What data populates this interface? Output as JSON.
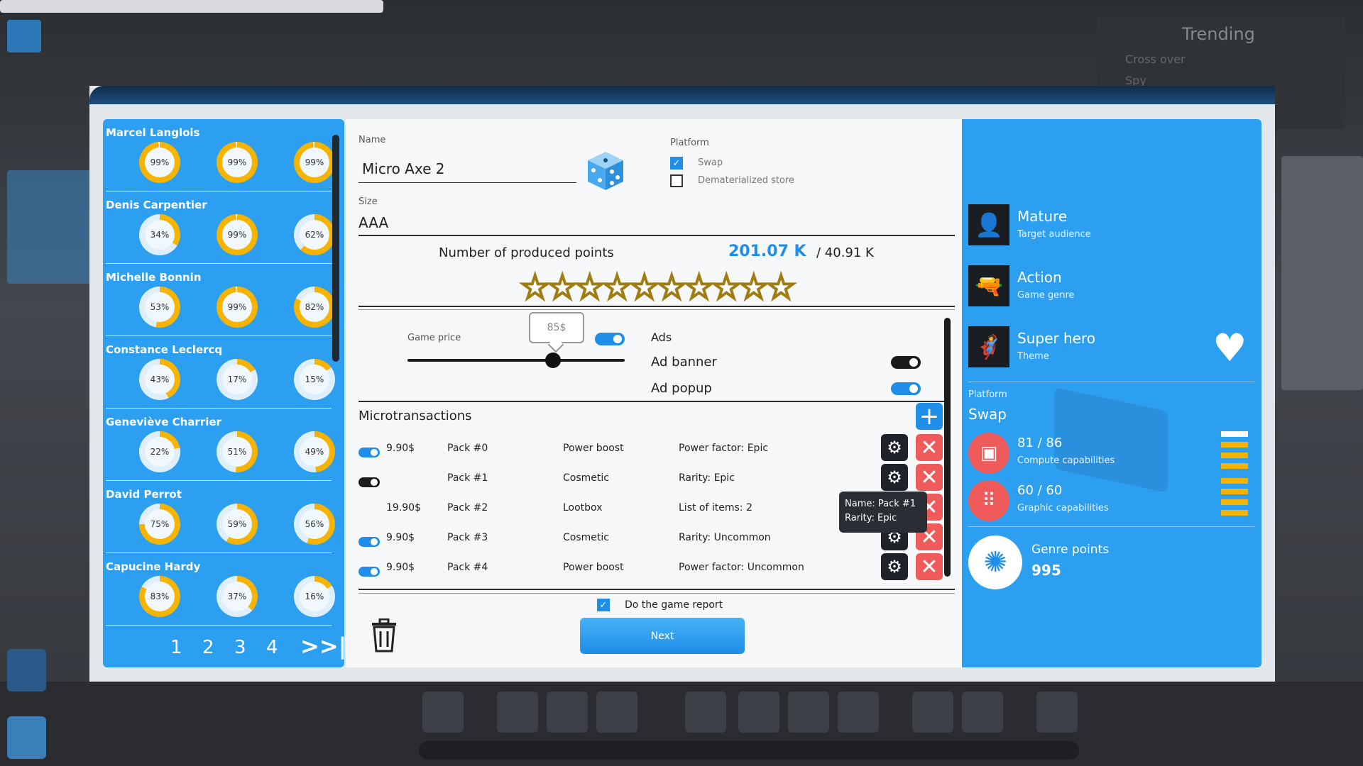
{
  "background": {
    "trending_title": "Trending",
    "trending_items": [
      "Cross over",
      "Spy"
    ],
    "side_label": "Micro Axe 2"
  },
  "employees": [
    {
      "name": "Marcel Langlois",
      "stats": [
        "99%",
        "99%",
        "99%"
      ],
      "fills": [
        0.99,
        0.99,
        0.99
      ]
    },
    {
      "name": "Denis Carpentier",
      "stats": [
        "34%",
        "99%",
        "62%"
      ],
      "fills": [
        0.34,
        0.99,
        0.62
      ]
    },
    {
      "name": "Michelle Bonnin",
      "stats": [
        "53%",
        "99%",
        "82%"
      ],
      "fills": [
        0.53,
        0.99,
        0.82
      ]
    },
    {
      "name": "Constance Leclercq",
      "stats": [
        "43%",
        "17%",
        "15%"
      ],
      "fills": [
        0.43,
        0.17,
        0.15
      ]
    },
    {
      "name": "Geneviève Charrier",
      "stats": [
        "22%",
        "51%",
        "49%"
      ],
      "fills": [
        0.22,
        0.51,
        0.49
      ]
    },
    {
      "name": "David Perrot",
      "stats": [
        "75%",
        "59%",
        "56%"
      ],
      "fills": [
        0.75,
        0.59,
        0.56
      ]
    },
    {
      "name": "Capucine Hardy",
      "stats": [
        "83%",
        "37%",
        "16%"
      ],
      "fills": [
        0.83,
        0.37,
        0.16
      ]
    }
  ],
  "pager": {
    "pages": [
      "1",
      "2",
      "3",
      "4"
    ],
    "last": ">>|"
  },
  "game": {
    "name_label": "Name",
    "name_value": "Micro Axe 2",
    "platform_label": "Platform",
    "platforms": [
      {
        "label": "Swap",
        "checked": true
      },
      {
        "label": "Dematerialized store",
        "checked": false
      }
    ],
    "size_label": "Size",
    "size_value": "AAA",
    "points_label": "Number of produced points",
    "points_value": "201.07 K",
    "points_target": "/ 40.91 K",
    "stars": 10,
    "price_bubble": "85$",
    "price_label": "Game price",
    "price_level": 0.67,
    "ads_label": "Ads",
    "ads_on": true,
    "ad_banner_label": "Ad banner",
    "ad_banner_on": false,
    "ad_popup_label": "Ad popup",
    "ad_popup_on": true
  },
  "microtransactions": {
    "title": "Microtransactions",
    "rows": [
      {
        "toggle": "on",
        "price": "9.90$",
        "pack": "Pack #0",
        "type": "Power boost",
        "detail": "Power factor: Epic"
      },
      {
        "toggle": "off",
        "price": "",
        "pack": "Pack #1",
        "type": "Cosmetic",
        "detail": "Rarity: Epic"
      },
      {
        "toggle": "none",
        "price": "19.90$",
        "pack": "Pack #2",
        "type": "Lootbox",
        "detail": "List of items: 2"
      },
      {
        "toggle": "on",
        "price": "9.90$",
        "pack": "Pack #3",
        "type": "Cosmetic",
        "detail": "Rarity: Uncommon"
      },
      {
        "toggle": "on",
        "price": "9.90$",
        "pack": "Pack #4",
        "type": "Power boost",
        "detail": "Power factor: Uncommon"
      }
    ],
    "tooltip_line1": "Name: Pack #1",
    "tooltip_line2": "Rarity: Epic"
  },
  "footer": {
    "report_label": "Do the game report",
    "report_checked": true,
    "next_label": "Next"
  },
  "summary": {
    "audience_value": "Mature",
    "audience_label": "Target audience",
    "genre_value": "Action",
    "genre_label": "Game genre",
    "theme_value": "Super hero",
    "theme_label": "Theme",
    "platform_label": "Platform",
    "platform_value": "Swap",
    "compute_value": "81 / 86",
    "compute_label": "Compute capabilities",
    "graphic_value": "60 / 60",
    "graphic_label": "Graphic capabilities",
    "genre_points_label": "Genre points",
    "genre_points_value": "995"
  },
  "colors": {
    "accent": "#2d9ff0",
    "ring_fill": "#f6b400",
    "delete": "#ef5b5b",
    "toggle_on": "#1e8ee8"
  }
}
